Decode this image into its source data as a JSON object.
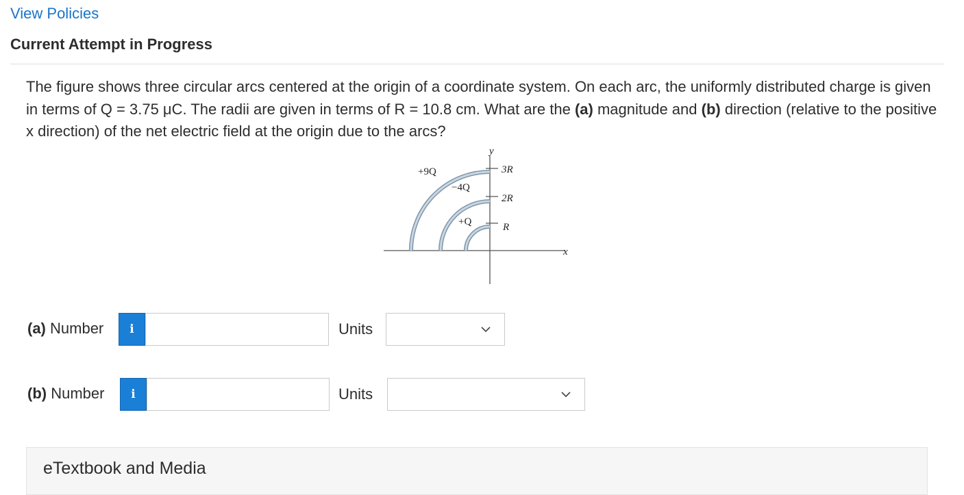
{
  "header": {
    "view_policies_link": "View Policies",
    "attempt_title": "Current Attempt in Progress"
  },
  "question": {
    "text_1": "The figure shows three circular arcs centered at the origin of a coordinate system. On each arc, the uniformly distributed charge is given in terms of Q = 3.75 μC. The radii are given in terms of R = 10.8 cm. What are the ",
    "part_a_marker": "(a)",
    "text_2": " magnitude and ",
    "part_b_marker": "(b)",
    "text_3": " direction (relative to the positive x direction) of the net electric field at the origin due to the arcs?"
  },
  "figure": {
    "y_axis_label": "y",
    "x_axis_label": "x",
    "charge_outer": "+9Q",
    "charge_middle": "−4Q",
    "charge_inner": "+Q",
    "radius_outer": "3R",
    "radius_middle": "2R",
    "radius_inner": "R"
  },
  "answers": {
    "a": {
      "label_marker": "(a)",
      "label_text": " Number",
      "info_icon": "i",
      "number_value": "",
      "units_label": "Units",
      "units_selected": ""
    },
    "b": {
      "label_marker": "(b)",
      "label_text": " Number",
      "info_icon": "i",
      "number_value": "",
      "units_label": "Units",
      "units_selected": ""
    }
  },
  "panel": {
    "title": "eTextbook and Media"
  },
  "colors": {
    "link": "#1a73c9",
    "info_button": "#1a7fd6",
    "arc_fill": "#b9c9d6"
  }
}
